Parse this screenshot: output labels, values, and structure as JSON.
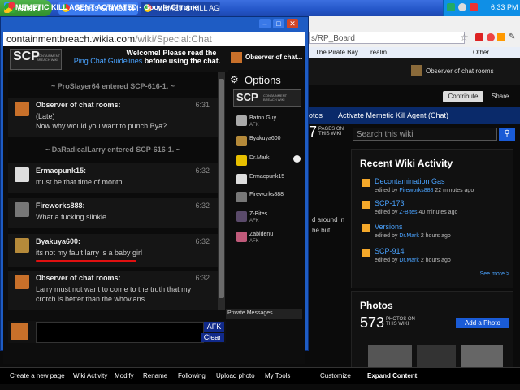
{
  "taskbar": {
    "start_label": "start",
    "tasks": [
      "Access Granted to Fil...",
      "MEMETIC KILL AGENT..."
    ],
    "clock": "6:33 PM"
  },
  "background_browser": {
    "url_tail": "s/RP_Board",
    "bookmarks": [
      "The Pirate Bay",
      "realm"
    ],
    "other_bookmarks": "Other bookmarks",
    "user": "Observer of chat rooms",
    "contribute": "Contribute",
    "share": "Share",
    "nav": [
      "otos",
      "Activate Memetic Kill Agent (Chat)"
    ],
    "pages_count": "7",
    "pages_label": "PAGES ON THIS WIKI",
    "search_placeholder": "Search this wiki",
    "body_text": [
      "d around in",
      "he but"
    ],
    "recent_activity": {
      "title": "Recent Wiki Activity",
      "items": [
        {
          "title": "Decontamination Gas",
          "by": "Fireworks888",
          "when": "22 minutes ago"
        },
        {
          "title": "SCP-173",
          "by": "Z-Bites",
          "when": "40 minutes ago"
        },
        {
          "title": "Versions",
          "by": "Dr.Mark",
          "when": "2 hours ago"
        },
        {
          "title": "SCP-914",
          "by": "Dr.Mark",
          "when": "2 hours ago"
        }
      ],
      "edited_by": "edited by",
      "see_more": "See more >"
    },
    "photos": {
      "title": "Photos",
      "count": "573",
      "label": "PHOTOS ON THIS WIKI",
      "add": "Add a Photo"
    },
    "bottom_bar": [
      "Create a new page",
      "Wiki Activity",
      "Modify",
      "Rename",
      "Following",
      "Upload photo",
      "My Tools",
      "Customize",
      "Expand Content"
    ]
  },
  "chat_window": {
    "title": "MEMETIC KILL AGENT ACTIVATED - Google Chrome",
    "url_host": "containmentbreach.wikia.com",
    "url_path": "/wiki/Special:Chat",
    "banner_line1": "Welcome! Please read the",
    "banner_link1": "Ping Chat Guidelines",
    "banner_line2": "before using the chat.",
    "current_user": "Observer of chat...",
    "options": "Options",
    "logo_text": "SCP",
    "logo_sub": "CONTAINMENT BREACH WIKI",
    "messages": [
      {
        "type": "inline",
        "text": "~ ProSlayer64 entered SCP-616-1. ~"
      },
      {
        "type": "msg",
        "name": "Observer of chat rooms:",
        "time": "6:31",
        "lines": [
          "(Late)",
          "Now why would you want to punch Bya?"
        ]
      },
      {
        "type": "inline",
        "text": "~ DaRadicalLarry entered SCP-616-1. ~"
      },
      {
        "type": "msg",
        "name": "Ermacpunk15:",
        "time": "6:32",
        "lines": [
          "must be that time of month"
        ]
      },
      {
        "type": "msg",
        "name": "Fireworks888:",
        "time": "6:32",
        "lines": [
          "What a fucking slinkie"
        ]
      },
      {
        "type": "msg",
        "name": "Byakuya600:",
        "time": "6:32",
        "lines": [
          "its not my fault larry is a baby girl"
        ]
      },
      {
        "type": "msg",
        "name": "Observer of chat rooms:",
        "time": "6:32",
        "lines": [
          "Larry must not want to come to the truth that my crotch is better than the whovians"
        ]
      }
    ],
    "users": [
      {
        "name": "Baton Guy",
        "status": "AFK"
      },
      {
        "name": "Byakuya600",
        "status": ""
      },
      {
        "name": "Dr.Mark",
        "status": ""
      },
      {
        "name": "Ermacpunk15",
        "status": ""
      },
      {
        "name": "Fireworks888",
        "status": ""
      },
      {
        "name": "Z-Bites",
        "status": "AFK"
      },
      {
        "name": "Zabidenu",
        "status": "AFK"
      }
    ],
    "private_messages": "Private Messages",
    "afk_button": "AFK",
    "clear_button": "Clear"
  }
}
